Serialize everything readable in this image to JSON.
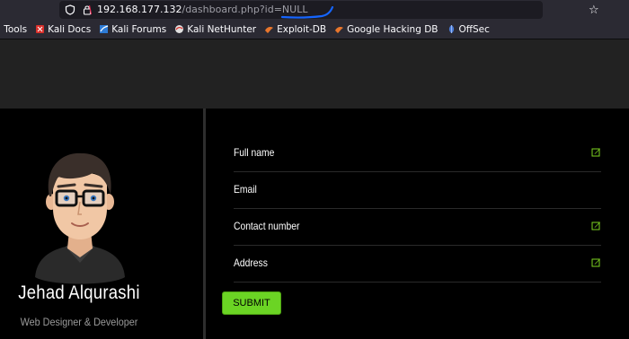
{
  "browser": {
    "url_host": "192.168.177.132",
    "url_path": "/dashboard.php?id=NULL",
    "bookmarks": [
      "i Tools",
      "Kali Docs",
      "Kali Forums",
      "Kali NetHunter",
      "Exploit-DB",
      "Google Hacking DB",
      "OffSec"
    ]
  },
  "profile": {
    "name": "Jehad Alqurashi",
    "role": "Web Designer & Developer"
  },
  "form": {
    "fields": [
      {
        "label": "Full name",
        "editable": true
      },
      {
        "label": "Email",
        "editable": false
      },
      {
        "label": "Contact number",
        "editable": true
      },
      {
        "label": "Address",
        "editable": true
      }
    ],
    "submit_label": "SUBMIT"
  },
  "colors": {
    "accent": "#6bd424",
    "edit_icon": "#7ed321",
    "annotation": "#1565ff"
  }
}
